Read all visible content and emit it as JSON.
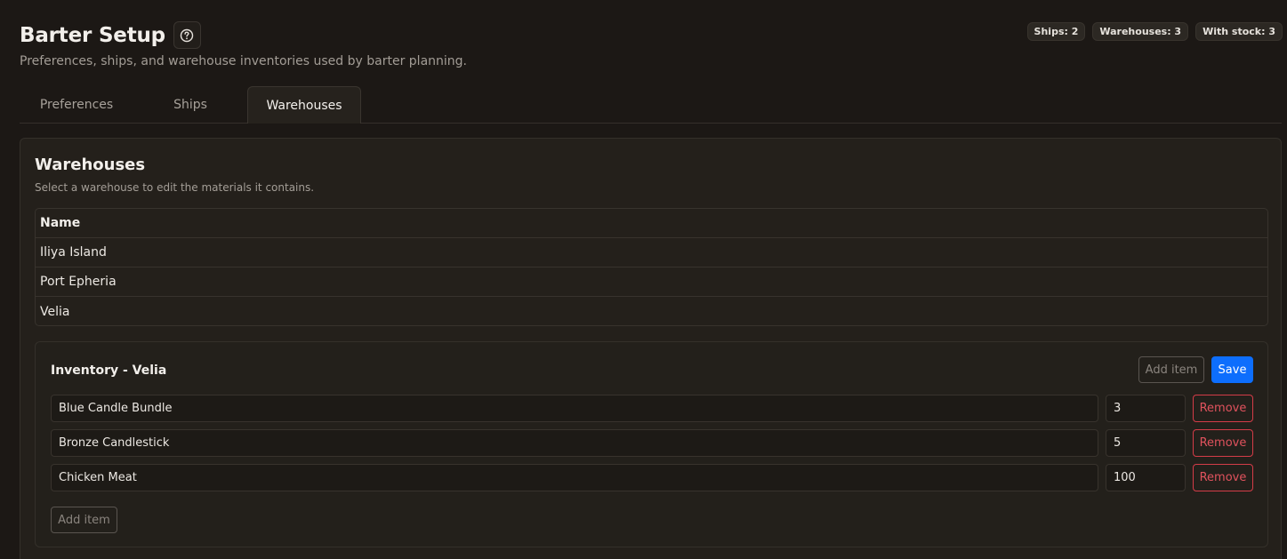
{
  "header": {
    "title": "Barter Setup",
    "subtitle": "Preferences, ships, and warehouse inventories used by barter planning.",
    "help_icon": "question-circle-icon"
  },
  "badges": [
    "Ships: 2",
    "Warehouses: 3",
    "With stock: 3"
  ],
  "tabs": [
    {
      "label": "Preferences",
      "active": false
    },
    {
      "label": "Ships",
      "active": false
    },
    {
      "label": "Warehouses",
      "active": true
    }
  ],
  "warehouses": {
    "title": "Warehouses",
    "description": "Select a warehouse to edit the materials it contains.",
    "table_header": "Name",
    "rows": [
      "Iliya Island",
      "Port Epheria",
      "Velia"
    ]
  },
  "inventory": {
    "title": "Inventory - Velia",
    "add_item_label": "Add item",
    "save_label": "Save",
    "remove_label": "Remove",
    "items": [
      {
        "name": "Blue Candle Bundle",
        "qty": "3"
      },
      {
        "name": "Bronze Candlestick",
        "qty": "5"
      },
      {
        "name": "Chicken Meat",
        "qty": "100"
      }
    ]
  },
  "colors": {
    "background": "#1c1815",
    "primary": "#0d6efd",
    "danger": "#dc3545"
  }
}
